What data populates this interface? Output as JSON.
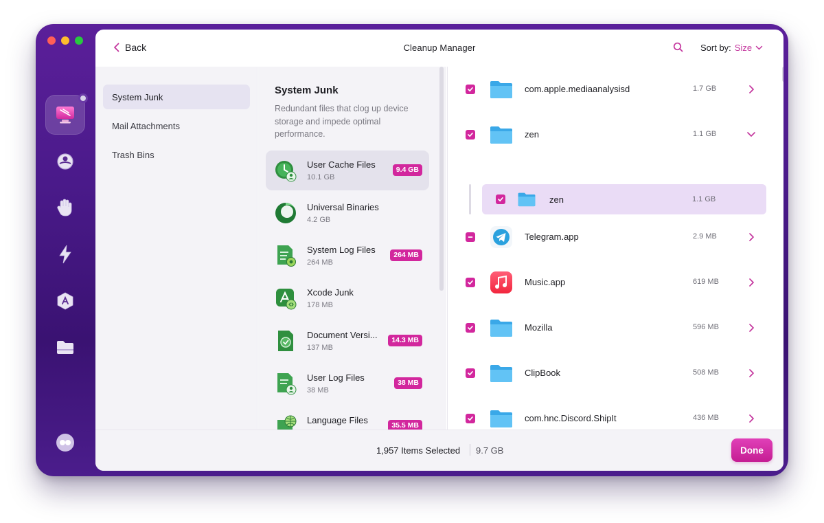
{
  "app": {
    "title": "Cleanup Manager",
    "back_label": "Back",
    "sort_label": "Sort by:",
    "sort_value": "Size",
    "accent_color": "#d2279d"
  },
  "rail": {
    "items": [
      {
        "icon": "cleanup-display-icon",
        "active": true
      },
      {
        "icon": "protection-icon"
      },
      {
        "icon": "privacy-hand-icon"
      },
      {
        "icon": "speed-bolt-icon"
      },
      {
        "icon": "applications-icon"
      },
      {
        "icon": "files-folder-icon"
      },
      {
        "icon": "assistant-icon"
      }
    ]
  },
  "categories": [
    {
      "label": "System Junk",
      "active": true
    },
    {
      "label": "Mail Attachments"
    },
    {
      "label": "Trash Bins"
    }
  ],
  "detail": {
    "title": "System Junk",
    "description": "Redundant files that clog up device storage and impede optimal performance."
  },
  "groups": [
    {
      "name": "User Cache Files",
      "size": "10.1 GB",
      "selected": "9.4 GB",
      "icon": "user-cache-icon"
    },
    {
      "name": "Universal Binaries",
      "size": "4.2 GB",
      "selected": "",
      "icon": "universal-binaries-icon"
    },
    {
      "name": "System Log Files",
      "size": "264 MB",
      "selected": "264 MB",
      "icon": "system-log-icon"
    },
    {
      "name": "Xcode Junk",
      "size": "178 MB",
      "selected": "",
      "icon": "xcode-junk-icon"
    },
    {
      "name": "Document Versi...",
      "size": "137 MB",
      "selected": "14.3 MB",
      "icon": "document-versions-icon"
    },
    {
      "name": "User Log Files",
      "size": "38 MB",
      "selected": "38 MB",
      "icon": "user-log-icon"
    },
    {
      "name": "Language Files",
      "size": "",
      "selected": "35.5 MB",
      "icon": "language-files-icon"
    }
  ],
  "files": [
    {
      "name": "com.apple.mediaanalysisd",
      "size": "1.7 GB",
      "state": "checked",
      "icon": "folder-icon",
      "expanded": false
    },
    {
      "name": "zen",
      "size": "1.1 GB",
      "state": "checked",
      "icon": "folder-icon",
      "expanded": true,
      "children": [
        {
          "name": "zen",
          "size": "1.1 GB",
          "state": "checked",
          "icon": "folder-icon"
        }
      ]
    },
    {
      "name": "Telegram.app",
      "size": "2.9 MB",
      "state": "mixed",
      "icon": "telegram-icon",
      "expanded": false
    },
    {
      "name": "Music.app",
      "size": "619 MB",
      "state": "checked",
      "icon": "music-icon",
      "expanded": false
    },
    {
      "name": "Mozilla",
      "size": "596 MB",
      "state": "checked",
      "icon": "folder-icon",
      "expanded": false
    },
    {
      "name": "ClipBook",
      "size": "508 MB",
      "state": "checked",
      "icon": "folder-icon",
      "expanded": false
    },
    {
      "name": "com.hnc.Discord.ShipIt",
      "size": "436 MB",
      "state": "checked",
      "icon": "folder-icon",
      "expanded": false
    }
  ],
  "footer": {
    "items_selected": "1,957 Items Selected",
    "total_size": "9.7 GB",
    "done_label": "Done"
  }
}
